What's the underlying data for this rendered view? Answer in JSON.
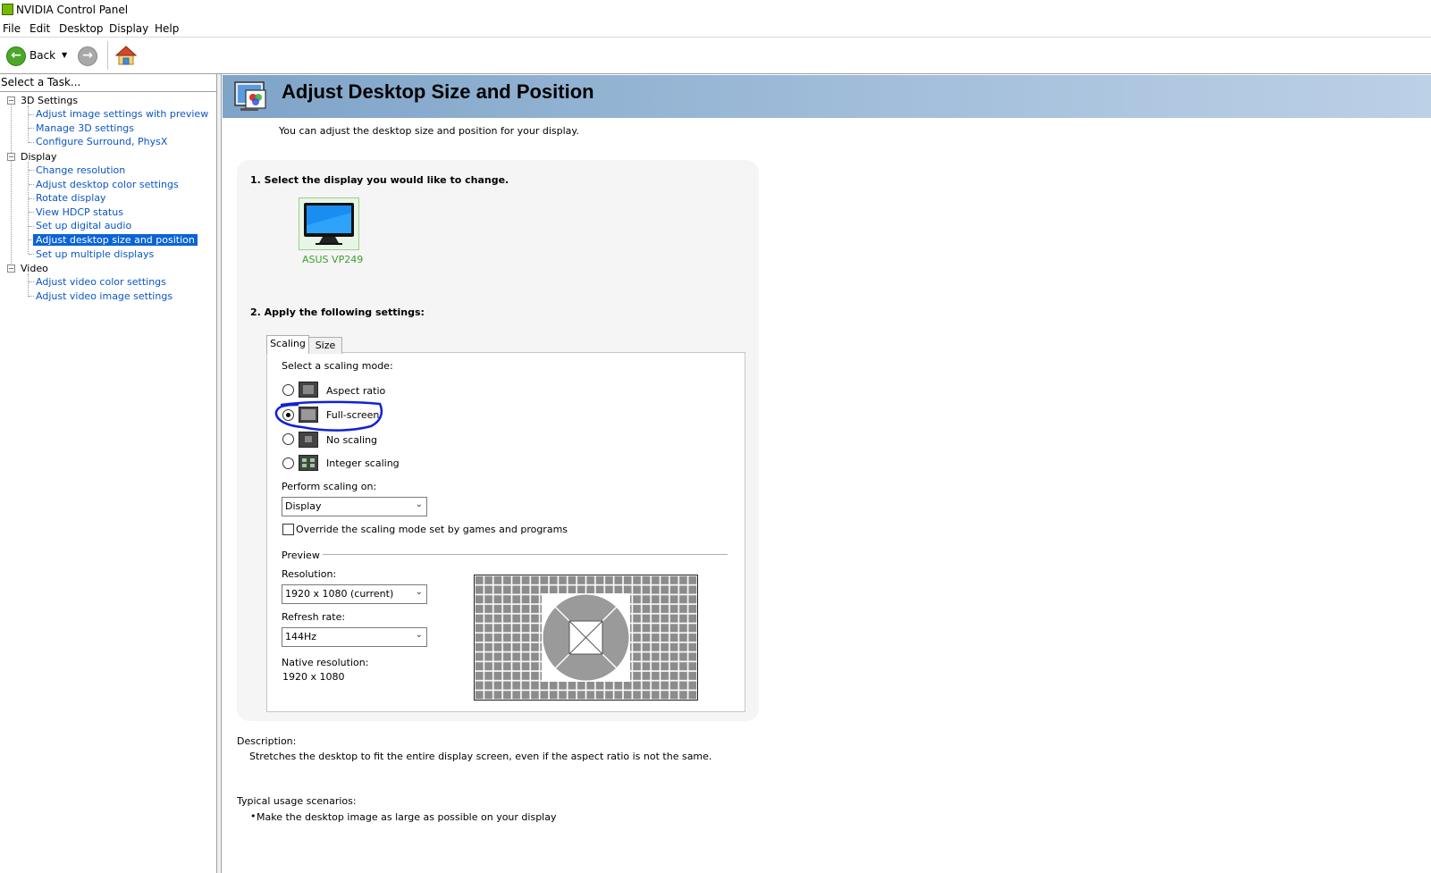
{
  "window": {
    "title": "NVIDIA Control Panel"
  },
  "menubar": {
    "items": [
      "File",
      "Edit",
      "Desktop",
      "Display",
      "Help"
    ]
  },
  "toolbar": {
    "back_label": "Back"
  },
  "sidebar": {
    "header": "Select a Task...",
    "categories": [
      {
        "label": "3D Settings",
        "items": [
          "Adjust image settings with preview",
          "Manage 3D settings",
          "Configure Surround, PhysX"
        ]
      },
      {
        "label": "Display",
        "items": [
          "Change resolution",
          "Adjust desktop color settings",
          "Rotate display",
          "View HDCP status",
          "Set up digital audio",
          "Adjust desktop size and position",
          "Set up multiple displays"
        ]
      },
      {
        "label": "Video",
        "items": [
          "Adjust video color settings",
          "Adjust video image settings"
        ]
      }
    ],
    "selected_item": "Adjust desktop size and position"
  },
  "page": {
    "title": "Adjust Desktop Size and Position",
    "intro": "You can adjust the desktop size and position for your display.",
    "step1": "1. Select the display you would like to change.",
    "display_name": "ASUS VP249",
    "step2": "2. Apply the following settings:",
    "tabs": [
      "Scaling",
      "Size"
    ],
    "active_tab": "Scaling",
    "scaling_mode_label": "Select a scaling mode:",
    "scaling_options": [
      "Aspect ratio",
      "Full-screen",
      "No scaling",
      "Integer scaling"
    ],
    "selected_scaling": "Full-screen",
    "perform_on_label": "Perform scaling on:",
    "perform_on_value": "Display",
    "override_label": "Override the scaling mode set by games and programs",
    "override_checked": false,
    "preview_label": "Preview",
    "resolution_label": "Resolution:",
    "resolution_value": "1920 x 1080 (current)",
    "refresh_label": "Refresh rate:",
    "refresh_value": "144Hz",
    "native_label": "Native resolution:",
    "native_value": "1920 x 1080",
    "description_label": "Description:",
    "description_text": "Stretches the desktop to fit the entire display screen, even if the aspect ratio is not the same.",
    "usage_label": "Typical usage scenarios:",
    "usage_items": [
      "Make the desktop image as large as possible on your display"
    ]
  },
  "colors": {
    "link": "#0b55c4",
    "selection": "#0a64d6",
    "header_band": "#a5c0dc",
    "nvidia_green": "#3aa12b",
    "annotation_ink": "#1222d6"
  }
}
